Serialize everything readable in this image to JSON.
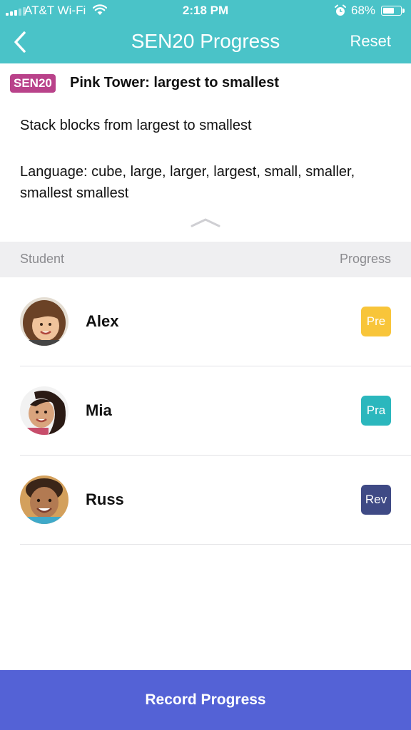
{
  "status_bar": {
    "carrier": "AT&T Wi-Fi",
    "time": "2:18 PM",
    "battery_percent": "68%",
    "battery_level": 0.68,
    "icons": [
      "signal-icon",
      "wifi-icon",
      "alarm-icon",
      "battery-icon"
    ]
  },
  "nav": {
    "title": "SEN20 Progress",
    "reset_label": "Reset",
    "back_icon": "chevron-left-icon",
    "background_color": "#4ac3c8"
  },
  "lesson": {
    "code": "SEN20",
    "code_color": "#b9428a",
    "title": "Pink Tower: largest to smallest",
    "description": "Stack blocks from largest to smallest",
    "language": "Language: cube, large, larger, largest, small, smaller, smallest smallest",
    "collapse_icon": "chevron-up-icon"
  },
  "table": {
    "headers": {
      "student": "Student",
      "progress": "Progress"
    },
    "rows": [
      {
        "name": "Alex",
        "progress": "Pre",
        "progress_color": "#f8c53a"
      },
      {
        "name": "Mia",
        "progress": "Pra",
        "progress_color": "#2bb7bd"
      },
      {
        "name": "Russ",
        "progress": "Rev",
        "progress_color": "#3f4a85"
      }
    ]
  },
  "footer": {
    "record_label": "Record Progress",
    "button_color": "#5462d6"
  }
}
